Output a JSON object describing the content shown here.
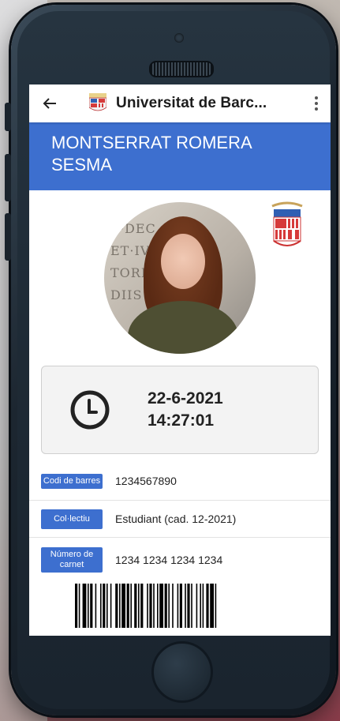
{
  "app": {
    "title": "Universitat de Barc...",
    "back_icon": "arrow-left-icon",
    "menu_icon": "more-vertical-icon"
  },
  "student": {
    "name": "MONTSERRAT ROMERA SESMA"
  },
  "datetime": {
    "date": "22-6-2021",
    "time": "14:27:01",
    "icon": "clock-icon"
  },
  "fields": [
    {
      "label": "Codi de barres",
      "value": "1234567890"
    },
    {
      "label": "Col·lectiu",
      "value": "Estudiant (cad. 12-2021)"
    },
    {
      "label": "Número de carnet",
      "value": "1234 1234 1234 1234"
    }
  ],
  "colors": {
    "accent": "#3d6fcf",
    "card_bg": "#f3f3f3",
    "text": "#222222"
  }
}
